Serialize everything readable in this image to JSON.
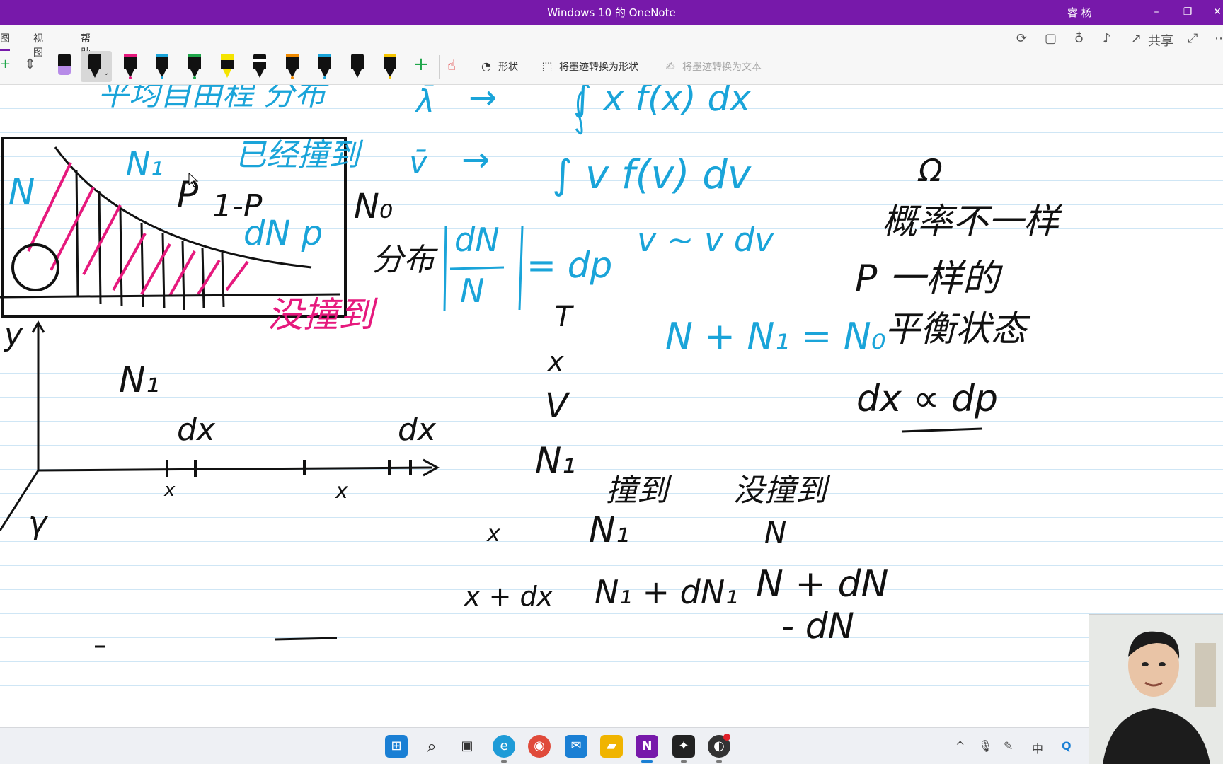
{
  "window": {
    "title": "Windows 10 的 OneNote",
    "user": "睿 杨",
    "minimize": "–",
    "restore": "❐",
    "close": "✕"
  },
  "ribbon": {
    "tabs": [
      {
        "label": "图"
      },
      {
        "label": "视图"
      },
      {
        "label": "帮助"
      }
    ],
    "right_icons": [
      "sync-icon",
      "notebook-icon",
      "lightbulb-icon",
      "bell-icon"
    ],
    "share_label": "共享",
    "expand_icon": "expand-icon",
    "more_icon": "more-icon",
    "pens": [
      {
        "color": "#b78be8"
      },
      {
        "color": "#111111"
      },
      {
        "color": "#e6197d"
      },
      {
        "color": "#1aa4d9"
      },
      {
        "color": "#1fa64a"
      },
      {
        "color": "#f5e400"
      },
      {
        "color": "#111111"
      },
      {
        "color": "#f08a00"
      },
      {
        "color": "#1aa4d9"
      },
      {
        "color": "#111111"
      },
      {
        "color": "#f5c400"
      }
    ],
    "add_pen": "+",
    "shape_label": "形状",
    "ink_to_shape_label": "将墨迹转换为形状",
    "ink_to_text_label": "将墨迹转换为文本"
  },
  "notes": {
    "title": "平均自由程 分布",
    "lambda_bar": "λ̄",
    "arrow1": "→",
    "integral1": "∫ x f(x) dx",
    "v_bar": "v̄",
    "arrow2": "→",
    "integral2": "∫ v f(v) dv",
    "v_range": "v ~ v dv",
    "n1_box": "N₁",
    "collided_box": "已经撞到",
    "n_box": "N",
    "p": "P",
    "one_minus_p": "1-P",
    "dn_p": "dN p",
    "n0": "N₀",
    "fenbu": "分布",
    "frac_top": "dN",
    "frac_bottom": "N",
    "eq_dp": "= dp",
    "not_collided_pink": "没撞到",
    "t": "T",
    "x1": "x",
    "v": "V",
    "n1_col": "N₁",
    "y_label": "y",
    "gamma": "γ",
    "n1_graph": "N₁",
    "dx_left": "dx",
    "dx_right": "dx",
    "x_left": "x",
    "x_right": "x",
    "n_eq": "N + N₁ = N₀",
    "omega": "Ω",
    "prob_diff": "概率不一样",
    "p_same": "P 一样的",
    "equilibrium": "平衡状态",
    "dx_prop": "dx ∝ dp",
    "hdr_collided": "撞到",
    "hdr_not_collided": "没撞到",
    "row1_x": "x",
    "row1_n1": "N₁",
    "row1_n": "N",
    "row2_x": "x + dx",
    "row2_n1": "N₁ + dN₁",
    "row2_n": "N + dN",
    "row3_n": "- dN"
  },
  "taskbar": {
    "apps": [
      {
        "name": "start-icon",
        "glyph": "⊞",
        "color": "#1a7fd4"
      },
      {
        "name": "search-icon",
        "glyph": "⌕",
        "color": "#333333"
      },
      {
        "name": "task-view-icon",
        "glyph": "▣",
        "color": "#333333"
      },
      {
        "name": "edge-icon",
        "glyph": "e",
        "color": "#1e9bd7"
      },
      {
        "name": "chrome-icon",
        "glyph": "◉",
        "color": "#e04a3a"
      },
      {
        "name": "mail-icon",
        "glyph": "✉",
        "color": "#1a7fd4"
      },
      {
        "name": "explorer-icon",
        "glyph": "▰",
        "color": "#f0b400"
      },
      {
        "name": "onenote-icon",
        "glyph": "N",
        "color": "#7719aa"
      },
      {
        "name": "app-icon",
        "glyph": "✦",
        "color": "#222222"
      },
      {
        "name": "recorder-icon",
        "glyph": "◐",
        "color": "#333333"
      }
    ],
    "tray": [
      {
        "name": "chevron-up-icon",
        "glyph": "^"
      },
      {
        "name": "microphone-icon",
        "glyph": "🎙"
      },
      {
        "name": "pen-icon",
        "glyph": "✎"
      },
      {
        "name": "ime-icon",
        "glyph": "中"
      },
      {
        "name": "q-icon",
        "glyph": "Q"
      }
    ]
  }
}
